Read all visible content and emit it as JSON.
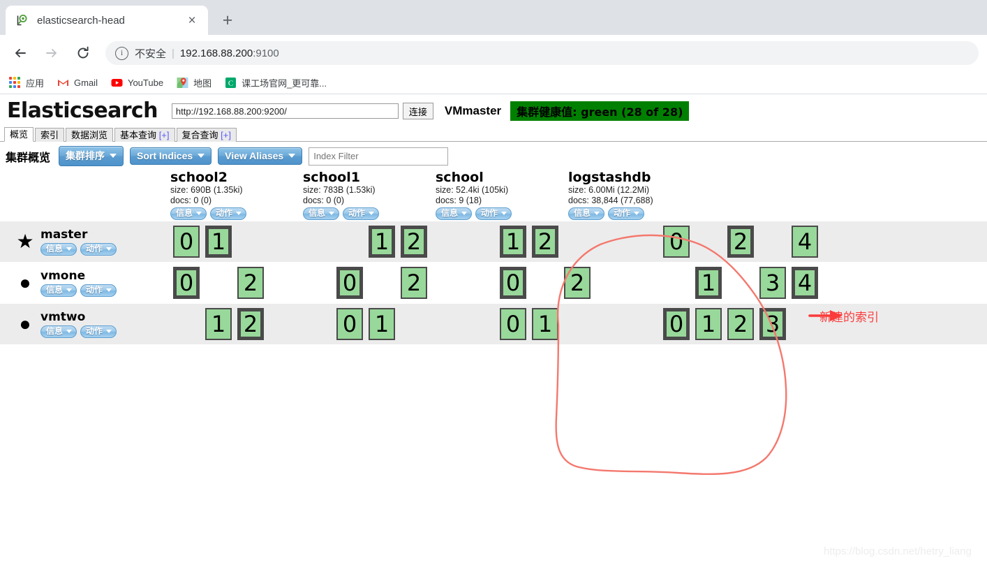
{
  "browser": {
    "tab": {
      "title": "elasticsearch-head",
      "favicon": "elasticsearch-head-favicon",
      "close_label": "×"
    },
    "new_tab_label": "+",
    "nav": {
      "back": "←",
      "forward": "→",
      "reload": "↻"
    },
    "omnibox": {
      "security_label": "不安全",
      "separator": "|",
      "url_host": "192.168.88.200",
      "url_port": ":9100"
    },
    "bookmarks": [
      {
        "label": "应用",
        "icon": "apps-grid-icon"
      },
      {
        "label": "Gmail",
        "icon": "gmail-icon"
      },
      {
        "label": "YouTube",
        "icon": "youtube-icon"
      },
      {
        "label": "地图",
        "icon": "google-maps-icon"
      },
      {
        "label": "课工场官网_更可靠...",
        "icon": "kgc-icon"
      }
    ]
  },
  "app": {
    "logo": "Elasticsearch",
    "url_value": "http://192.168.88.200:9200/",
    "connect_label": "连接",
    "cluster_name": "VMmaster",
    "health": {
      "text": "集群健康值: green (28 of 28)",
      "color": "#008000"
    },
    "tabs": [
      {
        "label": "概览",
        "active": true,
        "plus": ""
      },
      {
        "label": "索引",
        "active": false,
        "plus": ""
      },
      {
        "label": "数据浏览",
        "active": false,
        "plus": ""
      },
      {
        "label": "基本查询",
        "active": false,
        "plus": "[+]"
      },
      {
        "label": "复合查询",
        "active": false,
        "plus": "[+]"
      }
    ],
    "toolbar": {
      "title": "集群概览",
      "sort_cluster_label": "集群排序",
      "sort_indices_label": "Sort Indices",
      "view_aliases_label": "View Aliases",
      "index_filter_placeholder": "Index Filter"
    },
    "pill_info_label": "信息",
    "pill_action_label": "动作",
    "indices": [
      {
        "name": "school2",
        "size": "size: 690B (1.35ki)",
        "docs": "docs: 0 (0)"
      },
      {
        "name": "school1",
        "size": "size: 783B (1.53ki)",
        "docs": "docs: 0 (0)"
      },
      {
        "name": "school",
        "size": "size: 52.4ki (105ki)",
        "docs": "docs: 9 (18)"
      },
      {
        "name": "logstashdb",
        "size": "size: 6.00Mi (12.2Mi)",
        "docs": "docs: 38,844 (77,688)"
      }
    ],
    "nodes": [
      {
        "name": "master",
        "mark": "★",
        "mark_name": "master-star-icon"
      },
      {
        "name": "vmone",
        "mark": "●",
        "mark_name": "node-dot-icon"
      },
      {
        "name": "vmtwo",
        "mark": "●",
        "mark_name": "node-dot-icon"
      }
    ],
    "shards": [
      [
        [
          {
            "n": "0",
            "t": "replica"
          },
          {
            "n": "1",
            "t": "primary"
          },
          {
            "n": "",
            "t": "empty"
          },
          {
            "n": "",
            "t": "empty"
          },
          {
            "n": "",
            "t": "empty"
          }
        ],
        [
          {
            "n": "",
            "t": "empty"
          },
          {
            "n": "1",
            "t": "primary"
          },
          {
            "n": "2",
            "t": "primary"
          },
          {
            "n": "",
            "t": "empty"
          },
          {
            "n": "",
            "t": "empty"
          }
        ],
        [
          {
            "n": "1",
            "t": "primary"
          },
          {
            "n": "2",
            "t": "primary"
          },
          {
            "n": "",
            "t": "empty"
          },
          {
            "n": "",
            "t": "empty"
          },
          {
            "n": "",
            "t": "empty"
          }
        ],
        [
          {
            "n": "0",
            "t": "replica"
          },
          {
            "n": "",
            "t": "empty"
          },
          {
            "n": "2",
            "t": "primary"
          },
          {
            "n": "",
            "t": "empty"
          },
          {
            "n": "4",
            "t": "replica"
          }
        ]
      ],
      [
        [
          {
            "n": "0",
            "t": "primary"
          },
          {
            "n": "",
            "t": "empty"
          },
          {
            "n": "2",
            "t": "replica"
          },
          {
            "n": "",
            "t": "empty"
          },
          {
            "n": "",
            "t": "empty"
          }
        ],
        [
          {
            "n": "0",
            "t": "primary"
          },
          {
            "n": "",
            "t": "empty"
          },
          {
            "n": "2",
            "t": "replica"
          },
          {
            "n": "",
            "t": "empty"
          },
          {
            "n": "",
            "t": "empty"
          }
        ],
        [
          {
            "n": "0",
            "t": "primary"
          },
          {
            "n": "",
            "t": "empty"
          },
          {
            "n": "2",
            "t": "replica"
          },
          {
            "n": "",
            "t": "empty"
          },
          {
            "n": "",
            "t": "empty"
          }
        ],
        [
          {
            "n": "",
            "t": "empty"
          },
          {
            "n": "1",
            "t": "primary"
          },
          {
            "n": "",
            "t": "empty"
          },
          {
            "n": "3",
            "t": "replica"
          },
          {
            "n": "4",
            "t": "primary"
          }
        ]
      ],
      [
        [
          {
            "n": "",
            "t": "empty"
          },
          {
            "n": "1",
            "t": "replica"
          },
          {
            "n": "2",
            "t": "primary"
          },
          {
            "n": "",
            "t": "empty"
          },
          {
            "n": "",
            "t": "empty"
          }
        ],
        [
          {
            "n": "0",
            "t": "replica"
          },
          {
            "n": "1",
            "t": "replica"
          },
          {
            "n": "",
            "t": "empty"
          },
          {
            "n": "",
            "t": "empty"
          },
          {
            "n": "",
            "t": "empty"
          }
        ],
        [
          {
            "n": "0",
            "t": "replica"
          },
          {
            "n": "1",
            "t": "replica"
          },
          {
            "n": "",
            "t": "empty"
          },
          {
            "n": "",
            "t": "empty"
          },
          {
            "n": "",
            "t": "empty"
          }
        ],
        [
          {
            "n": "0",
            "t": "primary"
          },
          {
            "n": "1",
            "t": "replica"
          },
          {
            "n": "2",
            "t": "replica"
          },
          {
            "n": "3",
            "t": "primary"
          },
          {
            "n": "",
            "t": "empty"
          }
        ]
      ]
    ],
    "annotation": {
      "text": "新建的索引",
      "color": "#fb3b3b"
    },
    "watermark": "https://blog.csdn.net/hetry_liang"
  }
}
